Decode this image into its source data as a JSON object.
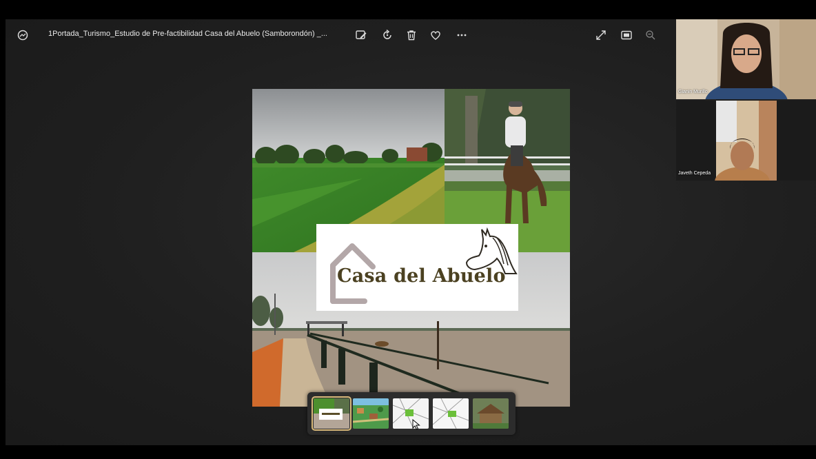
{
  "window": {
    "file_title": "1Portada_Turismo_Estudio de Pre-factibilidad Casa del Abuelo (Samborondón) _..."
  },
  "toolbar": {
    "items": [
      {
        "name": "edit-image-icon"
      },
      {
        "name": "rotate-icon"
      },
      {
        "name": "delete-icon"
      },
      {
        "name": "favorite-icon"
      },
      {
        "name": "more-icon"
      }
    ],
    "right_items": [
      {
        "name": "expand-icon"
      },
      {
        "name": "fit-window-icon"
      },
      {
        "name": "zoom-out-icon"
      }
    ]
  },
  "image": {
    "logo_text": "Casa del Abuelo"
  },
  "filmstrip": {
    "thumbnails": [
      {
        "name": "thumb-portada",
        "selected": true
      },
      {
        "name": "thumb-map-illustration",
        "selected": false
      },
      {
        "name": "thumb-site-plan-1",
        "selected": false
      },
      {
        "name": "thumb-site-plan-2",
        "selected": false
      },
      {
        "name": "thumb-house-photo",
        "selected": false
      }
    ]
  },
  "participants": [
    {
      "name": "Gianin Murillo"
    },
    {
      "name": "Javeth Cepeda"
    }
  ],
  "colors": {
    "viewer_bg": "#1f1f1f",
    "logo_text": "#4b4121",
    "selected_thumb": "#d9b97a"
  }
}
